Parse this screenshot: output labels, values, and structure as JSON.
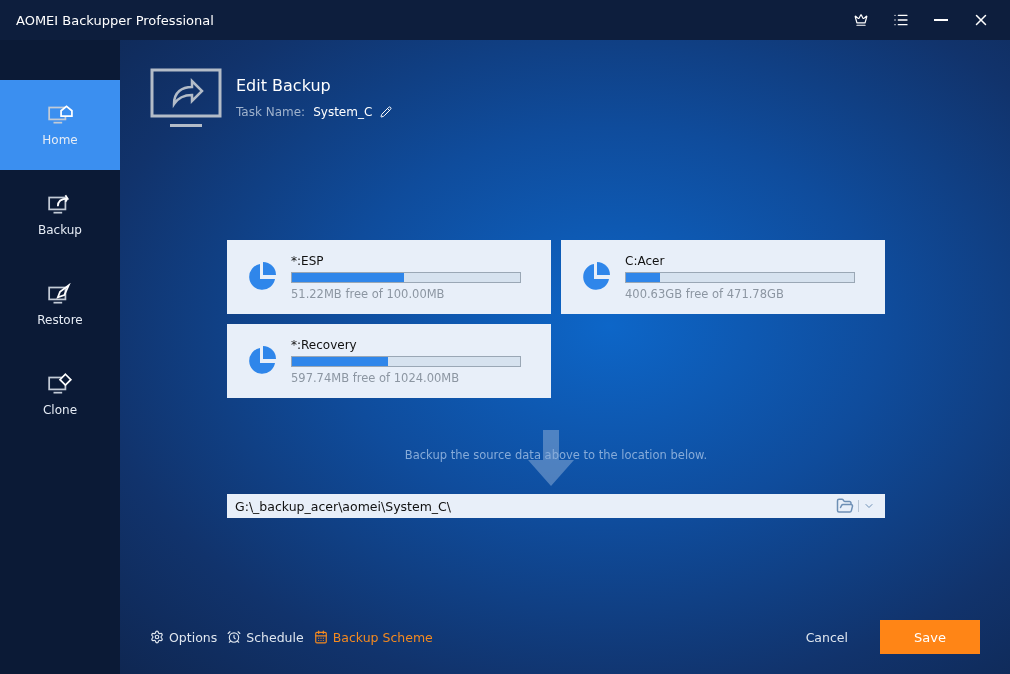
{
  "window": {
    "title": "AOMEI Backupper Professional"
  },
  "sidebar": {
    "items": [
      {
        "label": "Home",
        "selected": true
      },
      {
        "label": "Backup",
        "selected": false
      },
      {
        "label": "Restore",
        "selected": false
      },
      {
        "label": "Clone",
        "selected": false
      }
    ]
  },
  "header": {
    "title": "Edit Backup",
    "task_label": "Task Name:",
    "task_name": "System_C"
  },
  "partitions": [
    {
      "name": "*:ESP",
      "level": 0.49,
      "usage": "51.22MB free of 100.00MB"
    },
    {
      "name": "C:Acer",
      "level": 0.15,
      "usage": "400.63GB free of 471.78GB"
    },
    {
      "name": "*:Recovery",
      "level": 0.42,
      "usage": "597.74MB free of 1024.00MB"
    }
  ],
  "hint": "Backup the source data above to the location below.",
  "destination": {
    "value": "G:\\_backup_acer\\aomei\\System_C\\"
  },
  "footer_options": [
    {
      "kind": "gear",
      "label": "Options",
      "highlighted": false
    },
    {
      "kind": "clock",
      "label": "Schedule",
      "highlighted": false
    },
    {
      "kind": "calendar",
      "label": "Backup Scheme",
      "highlighted": true
    }
  ],
  "buttons": {
    "cancel": "Cancel",
    "save": "Save"
  }
}
